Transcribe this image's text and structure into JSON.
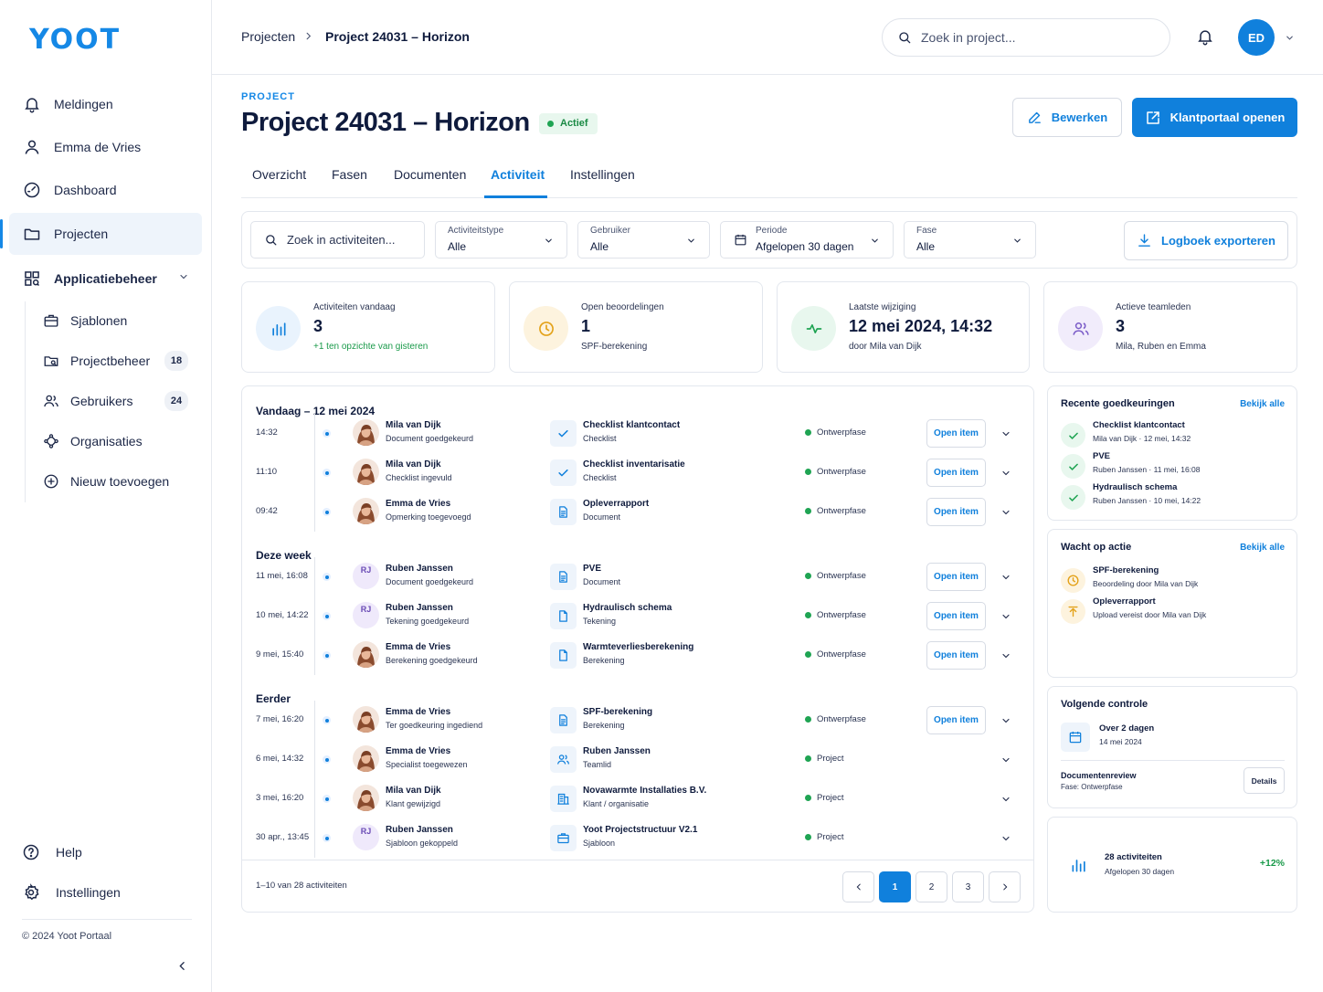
{
  "brand": {
    "logo": "YOOT",
    "accent": "#1080dc"
  },
  "sidebar": {
    "items": [
      {
        "label": "Meldingen",
        "icon": "bell-icon"
      },
      {
        "label": "Emma de Vries",
        "icon": "user-icon"
      },
      {
        "label": "Dashboard",
        "icon": "dashboard-icon"
      },
      {
        "label": "Projecten",
        "icon": "folder-icon",
        "active": true
      },
      {
        "label": "Applicatiebeheer",
        "icon": "apps-icon",
        "expanded": true
      }
    ],
    "subitems": [
      {
        "label": "Sjablonen",
        "icon": "briefcase-icon"
      },
      {
        "label": "Projectbeheer",
        "icon": "folder-search-icon",
        "count": "18"
      },
      {
        "label": "Gebruikers",
        "icon": "users-icon",
        "count": "24"
      },
      {
        "label": "Organisaties",
        "icon": "network-icon"
      },
      {
        "label": "Nieuw toevoegen",
        "icon": "plus-circle-icon"
      }
    ],
    "bottom": [
      {
        "label": "Help",
        "icon": "help-icon"
      },
      {
        "label": "Instellingen",
        "icon": "gear-icon"
      }
    ],
    "copyright": "© 2024 Yoot Portaal"
  },
  "topbar": {
    "breadcrumb": [
      "Projecten",
      "Project 24031 – Horizon"
    ],
    "search_placeholder": "Zoek in project...",
    "avatar_initials": "ED"
  },
  "header": {
    "eyebrow": "PROJECT",
    "title": "Project 24031 – Horizon",
    "status": "Actief",
    "edit_label": "Bewerken",
    "portal_label": "Klantportaal openen"
  },
  "tabs": [
    "Overzicht",
    "Fasen",
    "Documenten",
    "Activiteit",
    "Instellingen"
  ],
  "filters": {
    "search_placeholder": "Zoek in activiteiten...",
    "type": {
      "label": "Activiteitstype",
      "value": "Alle"
    },
    "user": {
      "label": "Gebruiker",
      "value": "Alle"
    },
    "period": {
      "label": "Periode",
      "value": "Afgelopen 30 dagen"
    },
    "phase": {
      "label": "Fase",
      "value": "Alle"
    },
    "export_label": "Logboek exporteren"
  },
  "kpis": [
    {
      "label": "Activiteiten vandaag",
      "value": "3",
      "sub": "+1 ten opzichte van gisteren",
      "icon": "bar-chart-icon",
      "color": "#1080dc",
      "bg": "#e9f3fd",
      "positive": true
    },
    {
      "label": "Open beoordelingen",
      "value": "1",
      "sub": "SPF-berekening",
      "icon": "clock-icon",
      "color": "#e3a21a",
      "bg": "#fdf3de"
    },
    {
      "label": "Laatste wijziging",
      "value": "12 mei 2024, 14:32",
      "sub": "door Mila van Dijk",
      "icon": "activity-icon",
      "color": "#1fa453",
      "bg": "#e8f7ee"
    },
    {
      "label": "Actieve teamleden",
      "value": "3",
      "sub": "Mila, Ruben en Emma",
      "icon": "users-icon",
      "color": "#7b5cc8",
      "bg": "#f1ecfb"
    }
  ],
  "feed": {
    "groups": [
      {
        "title": "Vandaag – 12 mei 2024",
        "rows": [
          {
            "time": "14:32",
            "user": "Mila van Dijk",
            "avatar": "photo",
            "action": "Document goedgekeurd",
            "object": "Checklist klantcontact",
            "type": "Checklist",
            "icon": "check-icon",
            "phase": "Ontwerpfase",
            "open": "Open item"
          },
          {
            "time": "11:10",
            "user": "Mila van Dijk",
            "avatar": "photo",
            "action": "Checklist ingevuld",
            "object": "Checklist inventarisatie",
            "type": "Checklist",
            "icon": "check-icon",
            "phase": "Ontwerpfase",
            "open": "Open item"
          },
          {
            "time": "09:42",
            "user": "Emma de Vries",
            "avatar": "photo",
            "action": "Opmerking toegevoegd",
            "object": "Opleverrapport",
            "type": "Document",
            "icon": "document-icon",
            "phase": "Ontwerpfase",
            "open": "Open item"
          }
        ]
      },
      {
        "title": "Deze week",
        "rows": [
          {
            "time": "11 mei, 16:08",
            "user": "Ruben Janssen",
            "avatar": "RJ",
            "action": "Document goedgekeurd",
            "object": "PVE",
            "type": "Document",
            "icon": "document-icon",
            "phase": "Ontwerpfase",
            "open": "Open item"
          },
          {
            "time": "10 mei, 14:22",
            "user": "Ruben Janssen",
            "avatar": "RJ",
            "action": "Tekening goedgekeurd",
            "object": "Hydraulisch schema",
            "type": "Tekening",
            "icon": "file-icon",
            "phase": "Ontwerpfase",
            "open": "Open item"
          },
          {
            "time": "9 mei, 15:40",
            "user": "Emma de Vries",
            "avatar": "photo",
            "action": "Berekening goedgekeurd",
            "object": "Warmteverliesberekening",
            "type": "Berekening",
            "icon": "file-icon",
            "phase": "Ontwerpfase",
            "open": "Open item"
          }
        ]
      },
      {
        "title": "Eerder",
        "rows": [
          {
            "time": "7 mei, 16:20",
            "user": "Emma de Vries",
            "avatar": "photo",
            "action": "Ter goedkeuring ingediend",
            "object": "SPF-berekening",
            "type": "Berekening",
            "icon": "document-icon",
            "phase": "Ontwerpfase",
            "open": "Open item"
          },
          {
            "time": "6 mei, 14:32",
            "user": "Emma de Vries",
            "avatar": "photo",
            "action": "Specialist toegewezen",
            "object": "Ruben Janssen",
            "type": "Teamlid",
            "icon": "users-icon",
            "phase": "Project",
            "open": ""
          },
          {
            "time": "3 mei, 16:20",
            "user": "Mila van Dijk",
            "avatar": "photo",
            "action": "Klant gewijzigd",
            "object": "Novawarmte Installaties B.V.",
            "type": "Klant / organisatie",
            "icon": "building-icon",
            "phase": "Project",
            "open": ""
          },
          {
            "time": "30 apr., 13:45",
            "user": "Ruben Janssen",
            "avatar": "RJ",
            "action": "Sjabloon gekoppeld",
            "object": "Yoot Projectstructuur V2.1",
            "type": "Sjabloon",
            "icon": "briefcase-icon",
            "phase": "Project",
            "open": ""
          }
        ]
      }
    ],
    "footer": "1–10 van 28 activiteiten",
    "pages": [
      "1",
      "2",
      "3"
    ],
    "current_page": "1"
  },
  "approvals": {
    "title": "Recente goedkeuringen",
    "link": "Bekijk alle",
    "items": [
      {
        "title": "Checklist klantcontact",
        "meta": "Mila van Dijk · 12 mei, 14:32"
      },
      {
        "title": "PVE",
        "meta": "Ruben Janssen · 11 mei, 16:08"
      },
      {
        "title": "Hydraulisch schema",
        "meta": "Ruben Janssen · 10 mei, 14:22"
      }
    ]
  },
  "waiting": {
    "title": "Wacht op actie",
    "link": "Bekijk alle",
    "items": [
      {
        "title": "SPF-berekening",
        "meta": "Beoordeling door Mila van Dijk",
        "icon": "clock-icon"
      },
      {
        "title": "Opleverrapport",
        "meta": "Upload vereist door Mila van Dijk",
        "icon": "upload-icon"
      }
    ]
  },
  "next_check": {
    "title": "Volgende controle",
    "when": "Over 2 dagen",
    "date": "14 mei 2024",
    "review": "Documentenreview",
    "phase": "Fase: Ontwerpfase",
    "details_label": "Details"
  },
  "stats": {
    "count": "28 activiteiten",
    "period": "Afgelopen 30 dagen",
    "change": "+12%"
  }
}
